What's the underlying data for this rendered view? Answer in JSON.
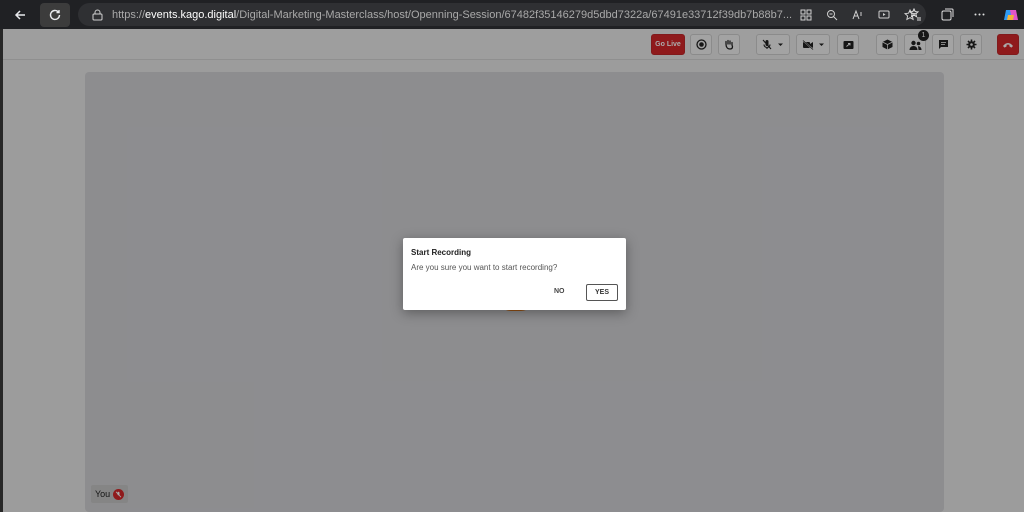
{
  "browser": {
    "url_proto": "https://",
    "url_host": "events.kago.digital",
    "url_path": "/Digital-Marketing-Masterclass/host/Openning-Session/67482f35146279d5dbd7322a/67491e33712f39db7b88b7..."
  },
  "toolbar": {
    "go_live_label": "Go Live",
    "participants_count": "1",
    "accent_color": "#d6282b"
  },
  "stage": {
    "self_label": "You"
  },
  "dialog": {
    "title": "Start Recording",
    "message": "Are you sure you want to start recording?",
    "no_label": "NO",
    "yes_label": "YES"
  }
}
